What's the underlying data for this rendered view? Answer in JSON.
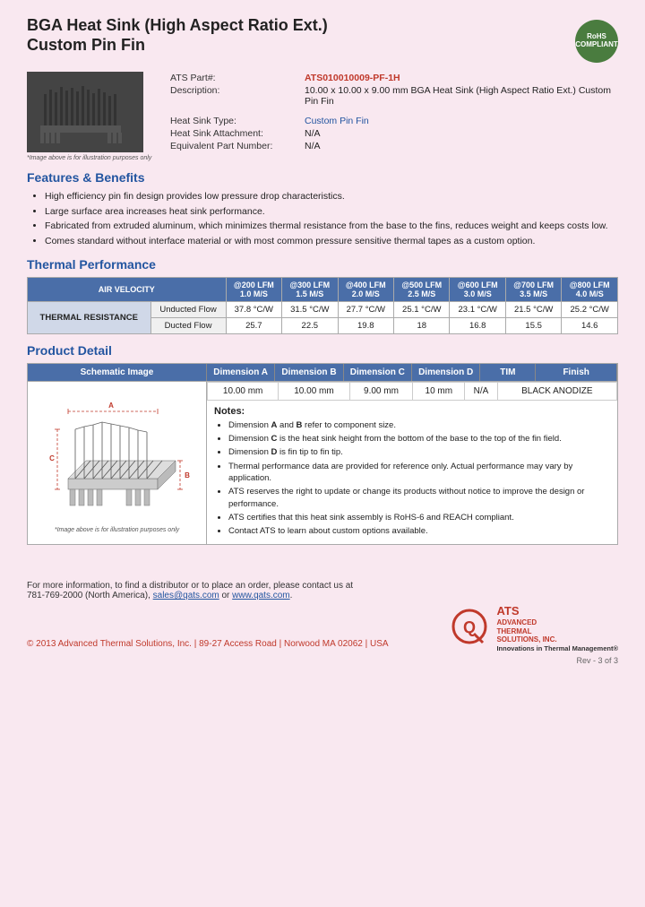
{
  "header": {
    "title_line1": "BGA Heat Sink (High Aspect Ratio Ext.)",
    "title_line2": "Custom Pin Fin",
    "rohs_line1": "RoHS",
    "rohs_line2": "COMPLIANT"
  },
  "part_info": {
    "ats_part_label": "ATS Part#:",
    "ats_part_number": "ATS010010009-PF-1H",
    "description_label": "Description:",
    "description_value": "10.00 x 10.00 x 9.00 mm  BGA Heat Sink (High Aspect Ratio Ext.) Custom Pin Fin",
    "heat_sink_type_label": "Heat Sink Type:",
    "heat_sink_type_value": "Custom Pin Fin",
    "attachment_label": "Heat Sink Attachment:",
    "attachment_value": "N/A",
    "equiv_part_label": "Equivalent Part Number:",
    "equiv_part_value": "N/A"
  },
  "image_caption": "*Image above is for illustration purposes only",
  "features": {
    "heading": "Features & Benefits",
    "items": [
      "High efficiency pin fin design provides low pressure drop characteristics.",
      "Large surface area increases heat sink performance.",
      "Fabricated from extruded aluminum, which minimizes thermal resistance from the base to the fins, reduces weight and keeps costs low.",
      "Comes standard without interface material or with most common pressure sensitive thermal tapes as a custom option."
    ]
  },
  "thermal_performance": {
    "heading": "Thermal Performance",
    "air_velocity_label": "AIR VELOCITY",
    "columns": [
      {
        "label": "@200 LFM",
        "sub": "1.0 M/S"
      },
      {
        "label": "@300 LFM",
        "sub": "1.5 M/S"
      },
      {
        "label": "@400 LFM",
        "sub": "2.0 M/S"
      },
      {
        "label": "@500 LFM",
        "sub": "2.5 M/S"
      },
      {
        "label": "@600 LFM",
        "sub": "3.0 M/S"
      },
      {
        "label": "@700 LFM",
        "sub": "3.5 M/S"
      },
      {
        "label": "@800 LFM",
        "sub": "4.0 M/S"
      }
    ],
    "thermal_resistance_label": "THERMAL RESISTANCE",
    "rows": [
      {
        "label": "Unducted Flow",
        "values": [
          "37.8 °C/W",
          "31.5 °C/W",
          "27.7 °C/W",
          "25.1 °C/W",
          "23.1 °C/W",
          "21.5 °C/W",
          "25.2 °C/W"
        ]
      },
      {
        "label": "Ducted Flow",
        "values": [
          "25.7",
          "22.5",
          "19.8",
          "18",
          "16.8",
          "15.5",
          "14.6"
        ]
      }
    ]
  },
  "product_detail": {
    "heading": "Product Detail",
    "schematic_label": "Schematic Image",
    "col_headers": [
      "Dimension A",
      "Dimension B",
      "Dimension C",
      "Dimension D",
      "TIM",
      "Finish"
    ],
    "dim_values": [
      "10.00 mm",
      "10.00 mm",
      "9.00 mm",
      "10 mm",
      "N/A",
      "BLACK ANODIZE"
    ],
    "schematic_caption": "*Image above is for illustration purposes only",
    "notes_heading": "Notes:",
    "notes": [
      "Dimension A and B refer to component size.",
      "Dimension C is the heat sink height from the bottom of the base to the top of the fin field.",
      "Dimension D is fin tip to fin tip.",
      "Thermal performance data are provided for reference only. Actual performance may vary by application.",
      "ATS reserves the right to update or change its products without notice to improve the design or performance.",
      "ATS certifies that this heat sink assembly is RoHS-6 and REACH compliant.",
      "Contact ATS to learn about custom options available."
    ]
  },
  "footer": {
    "contact_line": "For more information, to find a distributor or to place an order, please contact us at",
    "phone": "781-769-2000 (North America)",
    "email": "sales@qats.com",
    "website": "www.qats.com",
    "copyright": "© 2013 Advanced Thermal Solutions, Inc. | 89-27 Access Road  |  Norwood MA   02062  |  USA",
    "ats_name": "ATS",
    "ats_full": "ADVANCED\nTHERMAL\nSOLUTIONS, INC.",
    "ats_tagline": "Innovations in Thermal Management®",
    "page_number": "Rev - 3 of 3"
  }
}
